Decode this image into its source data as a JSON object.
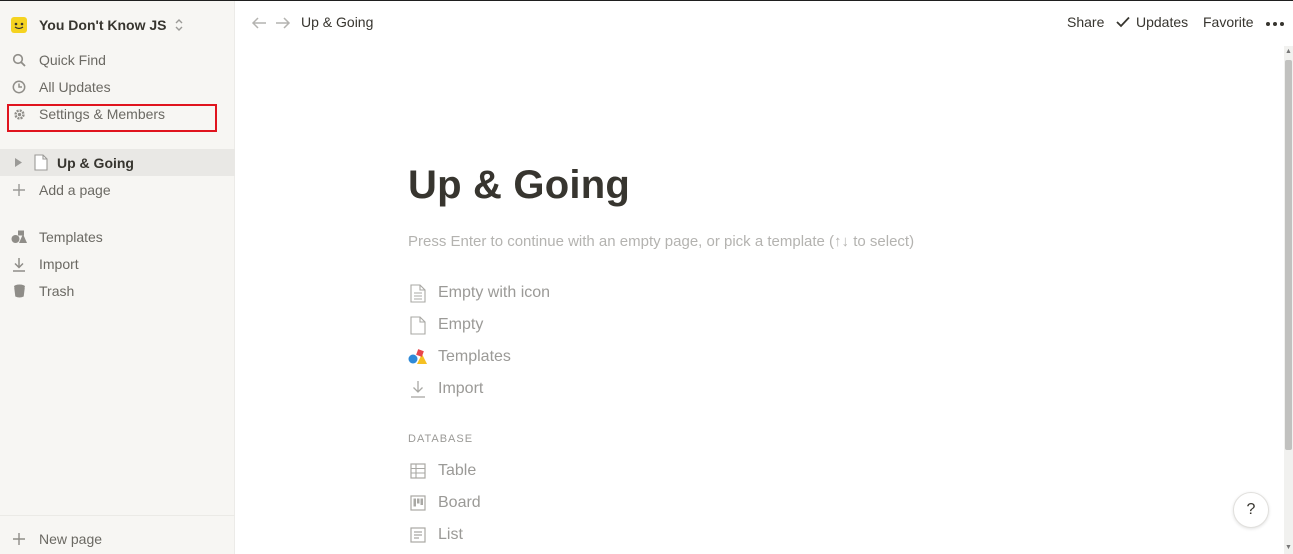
{
  "workspace": {
    "name": "You Don't Know JS"
  },
  "sidebar": {
    "items": [
      {
        "label": "Quick Find",
        "icon": "search-icon"
      },
      {
        "label": "All Updates",
        "icon": "clock-icon"
      },
      {
        "label": "Settings & Members",
        "icon": "gear-icon"
      }
    ],
    "page": {
      "label": "Up & Going",
      "icon": "page-icon"
    },
    "add_page": "Add a page",
    "tools": [
      {
        "label": "Templates",
        "icon": "templates-icon"
      },
      {
        "label": "Import",
        "icon": "import-icon"
      },
      {
        "label": "Trash",
        "icon": "trash-icon"
      }
    ],
    "new_page": "New page"
  },
  "topbar": {
    "breadcrumb": "Up & Going",
    "share": "Share",
    "updates": "Updates",
    "favorite": "Favorite"
  },
  "page": {
    "title": "Up & Going",
    "hint": "Press Enter to continue with an empty page, or pick a template (↑↓ to select)",
    "options": [
      {
        "label": "Empty with icon",
        "icon": "page-text-icon"
      },
      {
        "label": "Empty",
        "icon": "page-icon"
      },
      {
        "label": "Templates",
        "icon": "templates-icon"
      },
      {
        "label": "Import",
        "icon": "import-icon"
      }
    ],
    "database_label": "DATABASE",
    "database_options": [
      {
        "label": "Table",
        "icon": "table-icon"
      },
      {
        "label": "Board",
        "icon": "board-icon"
      },
      {
        "label": "List",
        "icon": "list-icon"
      }
    ]
  },
  "help": "?",
  "colors": {
    "highlight": "#e0141e",
    "sidebar_bg": "#f7f6f3",
    "text": "#37352f",
    "muted": "#9b9a97"
  }
}
